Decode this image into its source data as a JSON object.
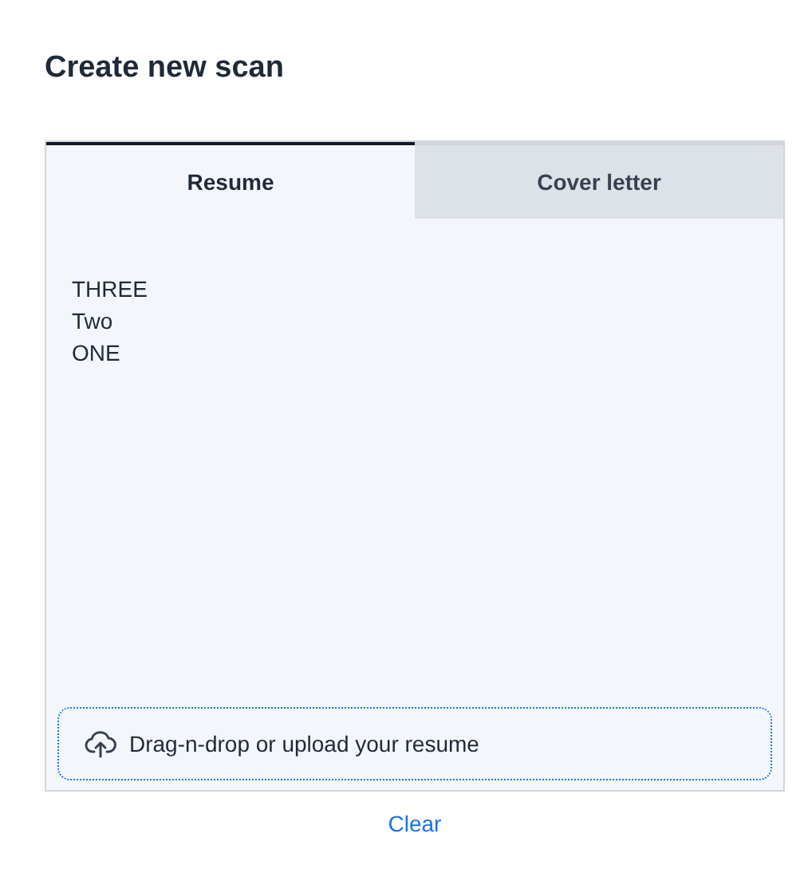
{
  "title": "Create new scan",
  "tabs": [
    {
      "label": "Resume",
      "selected": true
    },
    {
      "label": "Cover letter",
      "selected": false
    }
  ],
  "editor": {
    "value": "THREE\nTwo\nONE"
  },
  "dropzone": {
    "label": "Drag-n-drop or upload your resume"
  },
  "clear_link": "Clear"
}
